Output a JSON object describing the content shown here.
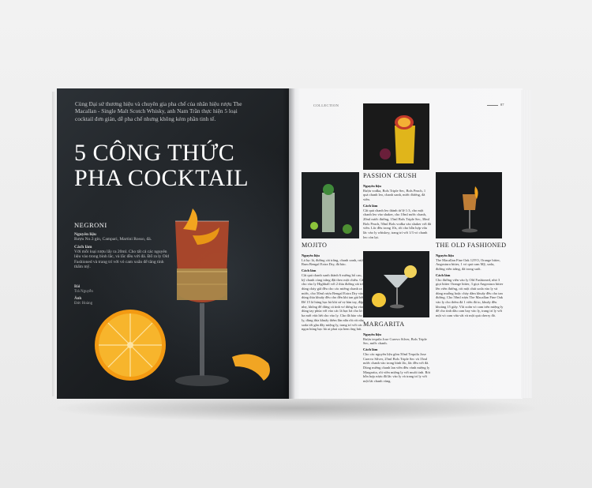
{
  "left_page": {
    "intro": "Cùng Đại sứ thương hiệu và chuyên gia pha chế của nhãn hiệu rượu The Macallan - Single Malt Scotch Whisky, anh Nam Trần thực hiện 5 loại cocktail đơn giản, dễ pha chế nhưng không kém phần tinh tế.",
    "title_line1": "5 Công Thức",
    "title_line2": "Pha Cocktail",
    "negroni": {
      "name": "NEGRONI",
      "ingredients_label": "Nguyên liệu",
      "ingredients": "Rượu No.3 gin, Campari, Martini Rosso, đá.",
      "method_label": "Cách làm",
      "method": "Với mỗi loại rượu lấy ra 20ml. Cho tất cả các nguyên liệu vào trong bình lắc, và lắc đều với đá. Đổ ra ly Old Fashioned và trang trí với vỏ cam xoắn để tăng tính thẩm mỹ."
    },
    "credits": {
      "text_label": "Bài",
      "text_name": "Trà Nguyễn",
      "photo_label": "Ảnh",
      "photo_name": "Đức Hoàng"
    }
  },
  "right_page": {
    "running_head": "COLLECTION",
    "page_number": "87",
    "recipes": [
      {
        "name": "PASSION CRUSH",
        "ingredients_label": "Nguyên liệu",
        "ingredients": "Rượu vodka, Bols Triple Sec, Bols Peach, 1 quả chanh leo, chanh xanh, nước đường, đá viên.",
        "method_label": "Cách làm",
        "method": "Cắt quả chanh leo thành từ lệ 1:3, cho một chanh leo vào shaker, cho 10ml nước chanh, 20ml nước đường, 15ml Bols Triple Sec, 30ml Bols Peach, 50ml Bols vodka vào shaker với đá viên. Lắc đều trong 10s, rồi cho hỗn hợp vừa lắc vào ly whiskey, trang trí với 1/3 vỏ chanh leo còn lại."
      },
      {
        "name": "MOJITO",
        "ingredients_label": "Nguyên liệu",
        "ingredients": "Lá lục lá, đường cát trắng, chanh xanh, rượu Rum Bengal Extra Dry, đá bào.",
        "method_label": "Cách làm",
        "method": "Cắt quả chanh xanh thành 6 miếng bổ cau, giã kỹ chanh cùng trắng đặt theo một chiều. Cắt và cho vào ly Highball với 2 thìa đường cát trắng, dùng chày giã đều cho các miếng chanh ra nước, cho 50ml rượu Bengal Extra Dry vào, dùng thìa khuấy đều cho đến khi tan giá hết. Để 15 lá húng bạc hà khi sử vẹ bàn tay, đập nhẹ, không để dừng cá tinh vơ dừng hạ vào, dùng tay phủa với vào các lá bạc hà cho là sắt ba mới vừa hết cho vào ly. Cho đá bào vào đầy ly, dùng thìa khuấy thêm lần nữa rồi rót nhẹ soda tới gần đầy miệng ly, trang trí với các ngọn húng bạc hà ai phai xịa hem ống hút."
      },
      {
        "name": "THE OLD FASHIONED",
        "ingredients_label": "Nguyên liệu",
        "ingredients": "The Macallan Fine Oak 12YO, Orange bitter, Angostura bitter, 1 vỏ quả cam Mỹ, soda, đường viên trắng, đá trong suốt.",
        "method_label": "Cách làm",
        "method": "Cho đường viên vào ly Old Fashioned, nhỏ 3 giọt bitter Orange bitter, 3 giọt Angostura bitter lên viên đường, rót một chút soda vào ly và dùng muỗng hoặc chày dầm khuấy đều cho tan đường. Cho 50ml rượu The Macallan Fine Oak vào ly cho thêm đá 1 viên đá to, khuấy đều khoảng 15 giây. Vắt xoắn vỏ cam trên miệng ly để cho tinh dầu cam bay vào ly, trang trí ly với một vỏ cam vừa vắt và một quả cherry đỏ."
      },
      {
        "name": "MARGARITA",
        "ingredients_label": "Nguyên liệu",
        "ingredients": "Rượu tequila Jose Cuervo Silver, Bols Triple Sec, nước chanh.",
        "method_label": "Cách làm",
        "method": "Cho các nguyên liệu gồm 50ml Tequila Jose Cuervo Silver, 25ml Bols Triple Sec và 15ml nước chanh vào trong bình lắc, lắc đều với đá. Dùng miếng chanh lan viền đều vành miệng ly Margarita, rồi viền miệng ly với muối tinh. Rót hỗn hợp rượu đã lắc vào ly và trang trí ly với một lát chanh vàng."
      }
    ]
  }
}
